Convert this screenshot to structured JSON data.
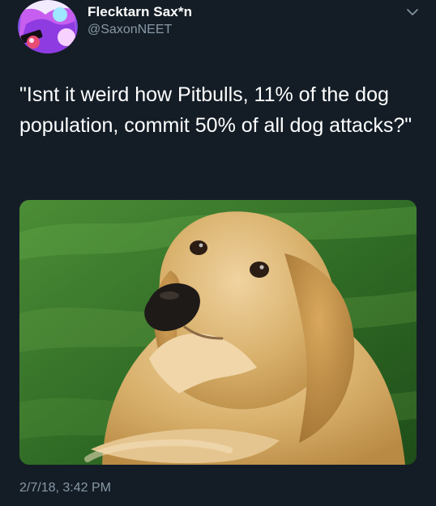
{
  "tweet": {
    "author": {
      "display_name": "Flecktarn Sax*n",
      "handle": "@SaxonNEET",
      "avatar_icon": "profile-avatar"
    },
    "text": "\"Isnt it weird how Pitbulls, 11% of the dog population, commit 50% of all dog attacks?\"",
    "timestamp": "2/7/18, 3:42 PM",
    "menu_icon": "chevron-down-icon",
    "image_icon": "dog-photo"
  },
  "colors": {
    "background": "#141d26",
    "primary_text": "#ffffff",
    "secondary_text": "#8899a6",
    "grass": "#3f7b2d",
    "dog_fur": "#d9b06b",
    "dog_nose": "#1e1a18"
  }
}
